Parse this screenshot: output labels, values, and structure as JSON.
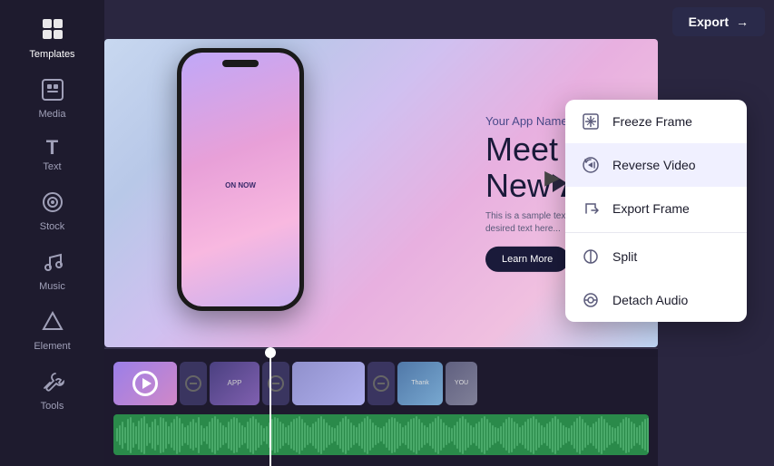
{
  "sidebar": {
    "items": [
      {
        "id": "templates",
        "label": "Templates",
        "icon": "⊞",
        "active": true
      },
      {
        "id": "media",
        "label": "Media",
        "icon": "⊕",
        "active": false
      },
      {
        "id": "text",
        "label": "Text",
        "icon": "T",
        "active": false
      },
      {
        "id": "stock",
        "label": "Stock",
        "icon": "◎",
        "active": false
      },
      {
        "id": "music",
        "label": "Music",
        "icon": "♫",
        "active": false
      },
      {
        "id": "element",
        "label": "Element",
        "icon": "◇",
        "active": false
      },
      {
        "id": "tools",
        "label": "Tools",
        "icon": "⚒",
        "active": false
      }
    ]
  },
  "header": {
    "export_label": "Export",
    "export_arrow": "→"
  },
  "app_promo": {
    "brand": "Your App Name",
    "headline_line1": "Meet Our",
    "headline_line2": "New",
    "headline_bold": "App",
    "description": "This is a sample text. In your desired text here...",
    "button_label": "Learn More"
  },
  "context_menu": {
    "items": [
      {
        "id": "freeze-frame",
        "label": "Freeze Frame",
        "icon": "❄"
      },
      {
        "id": "reverse-video",
        "label": "Reverse Video",
        "icon": "↺",
        "active": true
      },
      {
        "id": "export-frame",
        "label": "Export Frame",
        "icon": "↗"
      },
      {
        "id": "split",
        "label": "Split",
        "icon": "⊘"
      },
      {
        "id": "detach-audio",
        "label": "Detach Audio",
        "icon": "◉"
      }
    ]
  }
}
